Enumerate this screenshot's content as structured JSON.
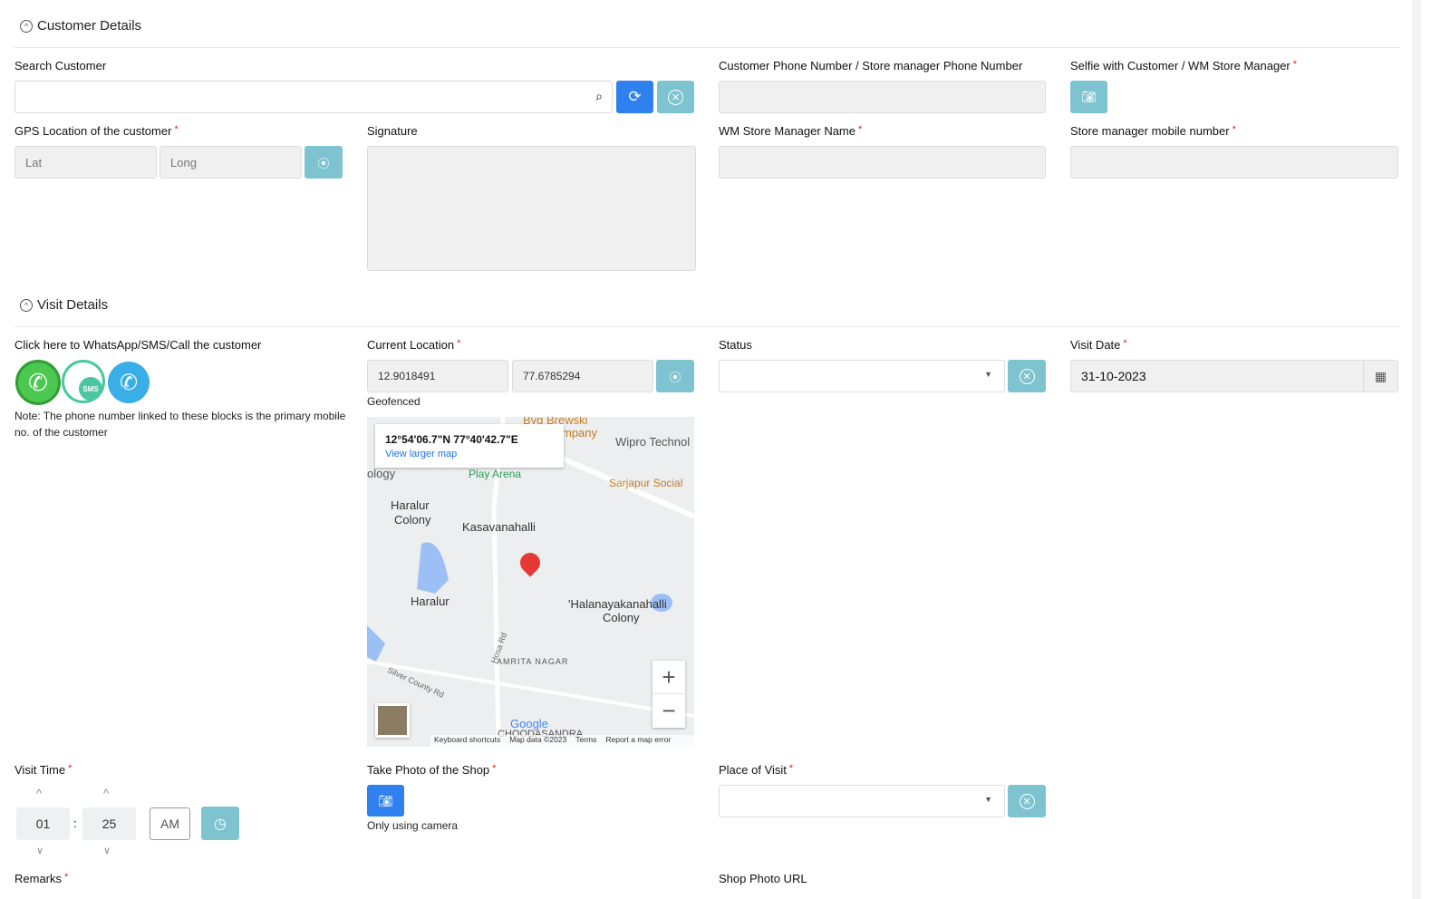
{
  "customer_section": {
    "title": "Customer Details",
    "search_label": "Search Customer",
    "search_value": "",
    "phone_label": "Customer Phone Number / Store manager Phone Number",
    "selfie_label": "Selfie with Customer / WM Store Manager",
    "gps_label": "GPS Location of the customer",
    "lat_placeholder": "Lat",
    "long_placeholder": "Long",
    "signature_label": "Signature",
    "manager_name_label": "WM Store Manager Name",
    "manager_mobile_label": "Store manager mobile number"
  },
  "visit_section": {
    "title": "Visit Details",
    "contact_label": "Click here to WhatsApp/SMS/Call the customer",
    "sms_text": "SMS",
    "note": "Note: The phone number linked to these blocks is the primary mobile no. of the customer",
    "current_location_label": "Current Location",
    "lat_value": "12.9018491",
    "long_value": "77.6785294",
    "geofenced": "Geofenced",
    "status_label": "Status",
    "status_value": "",
    "visit_date_label": "Visit Date",
    "visit_date_value": "31-10-2023",
    "visit_time_label": "Visit Time",
    "hour": "01",
    "minute": "25",
    "meridian": "AM",
    "time_sep": ":",
    "photo_label": "Take Photo of the Shop",
    "photo_note": "Only using camera",
    "place_label": "Place of Visit",
    "place_value": "",
    "remarks_label": "Remarks",
    "shop_photo_url_label": "Shop Photo URL"
  },
  "map": {
    "coords": "12°54'06.7\"N 77°40'42.7\"E",
    "larger_map": "View larger map",
    "places": [
      "Byq Brewski",
      "mpany",
      "Wipro Technol",
      "Play Arena",
      "Sarjapur Social",
      "Haralur",
      "Colony",
      "Kasavanahalli",
      "Haralur",
      "'Halanayakanahalli",
      "Colony",
      "AMRITA NAGAR",
      "Hosa Rd",
      "Silver County Rd",
      "ology",
      "CHOODASANDRA"
    ],
    "zoom_in": "+",
    "zoom_out": "−",
    "google": "Google",
    "footer": [
      "Keyboard shortcuts",
      "Map data ©2023",
      "Terms",
      "Report a map error"
    ]
  },
  "colors": {
    "primary": "#2f81f0",
    "teal": "#7ec4d0",
    "required": "#e02020"
  }
}
